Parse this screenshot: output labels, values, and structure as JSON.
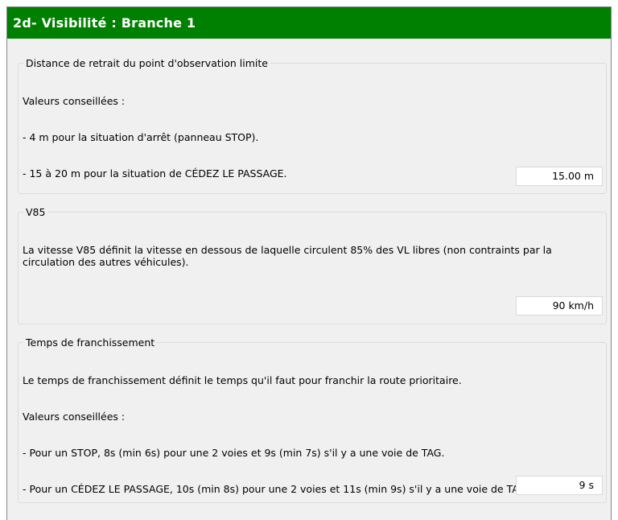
{
  "title": "2d- Visibilité : Branche 1",
  "colors": {
    "title_bar": "#008000",
    "title_text": "#ffffff",
    "panel_bg": "#f0f0f0"
  },
  "sections": [
    {
      "legend": "Distance de retrait du point d'observation limite",
      "lines": [
        "Valeurs conseillées :",
        "  - 4 m pour la situation d'arrêt (panneau STOP).",
        "  - 15 à 20 m pour la situation de CÉDEZ LE PASSAGE."
      ],
      "value": "15.00 m"
    },
    {
      "legend": "V85",
      "lines": [
        "La vitesse V85 définit la vitesse en dessous de laquelle circulent 85% des VL libres (non contraints par la circulation des autres véhicules)."
      ],
      "value": "90 km/h"
    },
    {
      "legend": "Temps de franchissement",
      "lines": [
        "Le temps de franchissement définit le temps qu'il faut pour franchir la route prioritaire.",
        "Valeurs conseillées :",
        "  - Pour un STOP, 8s (min 6s) pour une 2 voies et 9s (min 7s) s'il y a une voie de TAG.",
        "  - Pour un CÉDEZ LE PASSAGE, 10s (min 8s) pour une 2 voies et 11s (min 9s) s'il y a une voie de TAG."
      ],
      "value": "9 s"
    }
  ]
}
